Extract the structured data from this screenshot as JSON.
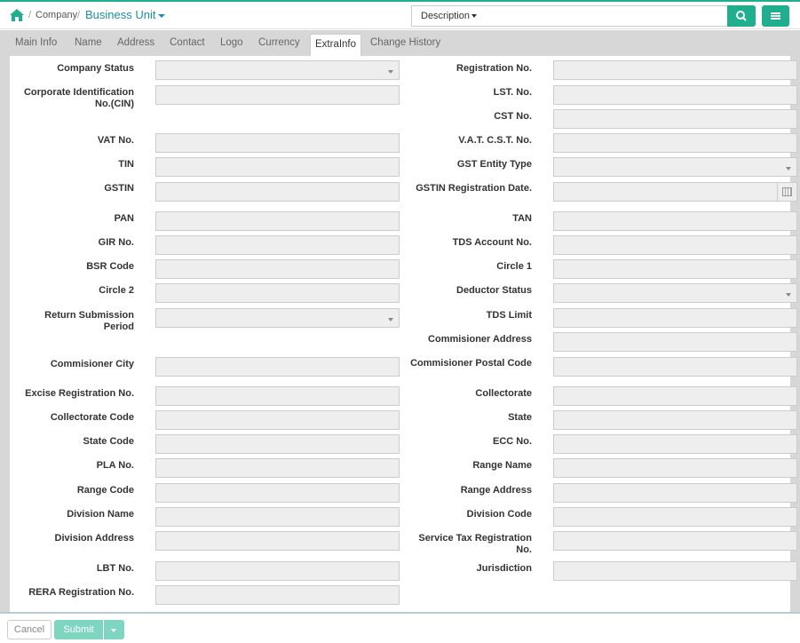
{
  "breadcrumb": {
    "company": "Company",
    "business_unit": "Business Unit"
  },
  "search": {
    "filter_label": "Description",
    "value": ""
  },
  "tabs": [
    {
      "label": "Main Info"
    },
    {
      "label": "Name"
    },
    {
      "label": "Address"
    },
    {
      "label": "Contact"
    },
    {
      "label": "Logo"
    },
    {
      "label": "Currency"
    },
    {
      "label": "ExtraInfo"
    },
    {
      "label": "Change History"
    }
  ],
  "active_tab": "ExtraInfo",
  "form": {
    "left": [
      {
        "label": "Company Status",
        "type": "select",
        "value": ""
      },
      {
        "label": "Corporate Identification No.(CIN)",
        "type": "text",
        "value": ""
      },
      {
        "label": "VAT No.",
        "type": "text",
        "value": ""
      },
      {
        "label": "TIN",
        "type": "text",
        "value": ""
      },
      {
        "label": "GSTIN",
        "type": "text",
        "value": ""
      },
      {
        "label": "PAN",
        "type": "text",
        "value": ""
      },
      {
        "label": "GIR No.",
        "type": "text",
        "value": ""
      },
      {
        "label": "BSR Code",
        "type": "text",
        "value": ""
      },
      {
        "label": "Circle 2",
        "type": "text",
        "value": ""
      },
      {
        "label": "Return Submission Period",
        "type": "select",
        "value": ""
      },
      {
        "label": "Commisioner City",
        "type": "text",
        "value": ""
      },
      {
        "label": "Excise Registration No.",
        "type": "text",
        "value": ""
      },
      {
        "label": "Collectorate Code",
        "type": "text",
        "value": ""
      },
      {
        "label": "State Code",
        "type": "text",
        "value": ""
      },
      {
        "label": "PLA No.",
        "type": "text",
        "value": ""
      },
      {
        "label": "Range Code",
        "type": "text",
        "value": ""
      },
      {
        "label": "Division Name",
        "type": "text",
        "value": ""
      },
      {
        "label": "Division Address",
        "type": "text",
        "value": ""
      },
      {
        "label": "LBT No.",
        "type": "text",
        "value": ""
      },
      {
        "label": "RERA Registration No.",
        "type": "text",
        "value": ""
      }
    ],
    "right": [
      {
        "label": "Registration No.",
        "type": "text",
        "value": ""
      },
      {
        "label": "LST. No.",
        "type": "text",
        "value": ""
      },
      {
        "label": "CST No.",
        "type": "text",
        "value": ""
      },
      {
        "label": "V.A.T. C.S.T. No.",
        "type": "text",
        "value": ""
      },
      {
        "label": "GST Entity Type",
        "type": "select",
        "value": ""
      },
      {
        "label": "GSTIN Registration Date.",
        "type": "date",
        "value": ""
      },
      {
        "label": "TAN",
        "type": "text",
        "value": ""
      },
      {
        "label": "TDS Account No.",
        "type": "text",
        "value": ""
      },
      {
        "label": "Circle 1",
        "type": "text",
        "value": ""
      },
      {
        "label": "Deductor Status",
        "type": "select",
        "value": ""
      },
      {
        "label": "TDS Limit",
        "type": "text",
        "value": ""
      },
      {
        "label": "Commisioner Address",
        "type": "text",
        "value": ""
      },
      {
        "label": "Commisioner Postal Code",
        "type": "text",
        "value": ""
      },
      {
        "label": "Collectorate",
        "type": "text",
        "value": ""
      },
      {
        "label": "State",
        "type": "text",
        "value": ""
      },
      {
        "label": "ECC No.",
        "type": "text",
        "value": ""
      },
      {
        "label": "Range Name",
        "type": "text",
        "value": ""
      },
      {
        "label": "Range Address",
        "type": "text",
        "value": ""
      },
      {
        "label": "Division Code",
        "type": "text",
        "value": ""
      },
      {
        "label": "Service Tax Registration No.",
        "type": "text",
        "value": ""
      },
      {
        "label": "Jurisdiction",
        "type": "text",
        "value": ""
      }
    ]
  },
  "footer": {
    "cancel_label": "Cancel",
    "submit_label": "Submit"
  },
  "colors": {
    "accent": "#1fae8e",
    "link": "#1a8fa8",
    "submit_disabled": "#7fd6c0"
  },
  "icons": {
    "home": "home-icon",
    "search": "search-icon",
    "menu": "menu-icon",
    "calendar": "calendar-icon"
  }
}
